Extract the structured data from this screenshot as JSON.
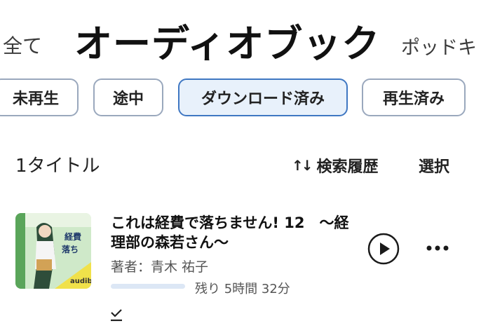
{
  "top_tabs": {
    "all": "全て",
    "audiobook": "オーディオブック",
    "podcast": "ポッドキ"
  },
  "filters": [
    {
      "label": "未再生",
      "selected": false
    },
    {
      "label": "途中",
      "selected": false
    },
    {
      "label": "ダウンロード済み",
      "selected": true
    },
    {
      "label": "再生済み",
      "selected": false
    }
  ],
  "list_header": {
    "count": "1タイトル",
    "sort_label": "検索履歴",
    "select_label": "選択"
  },
  "book": {
    "title": "これは経費で落ちません! 12　～経理部の森若さん～",
    "author": "著者：青木 祐子",
    "remaining": "残り 5時間 32分",
    "cover_brand": "audible",
    "cover_title": "これは経費で落ちません!"
  },
  "colors": {
    "accent": "#3f77c2",
    "chip_border": "#9aa8bd",
    "chip_selected_bg": "#e8f1fb",
    "progress_track": "#dce7f5"
  },
  "icons": {
    "sort": "sort-arrows-icon",
    "play": "play-icon",
    "more": "more-dots-icon",
    "downloaded": "download-check-icon"
  }
}
